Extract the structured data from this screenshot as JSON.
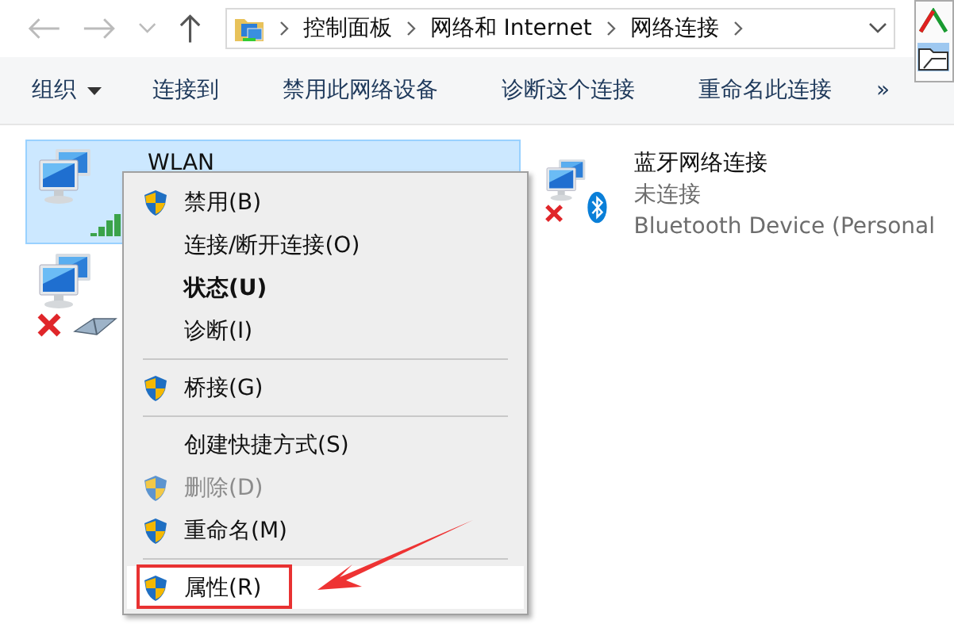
{
  "address_bar": {
    "crumbs": [
      "控制面板",
      "网络和 Internet",
      "网络连接"
    ]
  },
  "toolbar": {
    "items": [
      {
        "label": "组织",
        "dropdown": true
      },
      {
        "label": "连接到",
        "dropdown": false
      },
      {
        "label": "禁用此网络设备",
        "dropdown": false
      },
      {
        "label": "诊断这个连接",
        "dropdown": false
      },
      {
        "label": "重命名此连接",
        "dropdown": false
      }
    ],
    "overflow": "»"
  },
  "connections": [
    {
      "kind": "wifi",
      "name": "WLAN",
      "selected": true,
      "disconnected": false
    },
    {
      "kind": "bluetooth",
      "name": "蓝牙网络连接",
      "status": "未连接",
      "device": "Bluetooth Device (Personal",
      "selected": false,
      "disconnected": true
    },
    {
      "kind": "ethernet",
      "selected": false,
      "disconnected": true
    }
  ],
  "context_menu": {
    "items": [
      {
        "kind": "item",
        "label": "禁用(B)",
        "shield": true,
        "bold": false,
        "disabled": false,
        "highlighted": false
      },
      {
        "kind": "item",
        "label": "连接/断开连接(O)",
        "shield": false,
        "bold": false,
        "disabled": false,
        "highlighted": false
      },
      {
        "kind": "item",
        "label": "状态(U)",
        "shield": false,
        "bold": true,
        "disabled": false,
        "highlighted": false
      },
      {
        "kind": "item",
        "label": "诊断(I)",
        "shield": false,
        "bold": false,
        "disabled": false,
        "highlighted": false
      },
      {
        "kind": "separator"
      },
      {
        "kind": "item",
        "label": "桥接(G)",
        "shield": true,
        "bold": false,
        "disabled": false,
        "highlighted": false
      },
      {
        "kind": "separator"
      },
      {
        "kind": "item",
        "label": "创建快捷方式(S)",
        "shield": false,
        "bold": false,
        "disabled": false,
        "highlighted": false
      },
      {
        "kind": "item",
        "label": "删除(D)",
        "shield": true,
        "bold": false,
        "disabled": true,
        "highlighted": false
      },
      {
        "kind": "item",
        "label": "重命名(M)",
        "shield": true,
        "bold": false,
        "disabled": false,
        "highlighted": false
      },
      {
        "kind": "separator"
      },
      {
        "kind": "item",
        "label": "属性(R)",
        "shield": true,
        "bold": false,
        "disabled": false,
        "highlighted": true
      }
    ]
  }
}
